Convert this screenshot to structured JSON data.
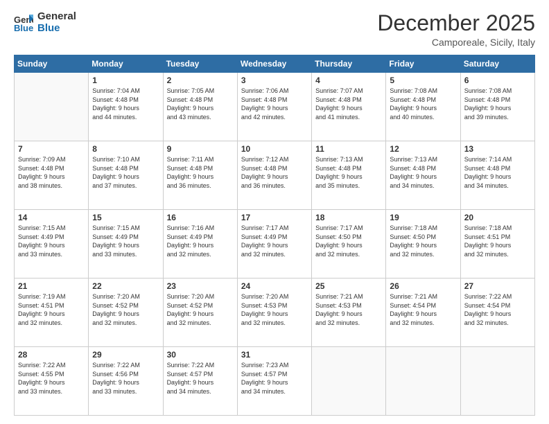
{
  "logo": {
    "line1": "General",
    "line2": "Blue"
  },
  "header": {
    "month": "December 2025",
    "location": "Camporeale, Sicily, Italy"
  },
  "weekdays": [
    "Sunday",
    "Monday",
    "Tuesday",
    "Wednesday",
    "Thursday",
    "Friday",
    "Saturday"
  ],
  "weeks": [
    [
      {
        "day": "",
        "info": ""
      },
      {
        "day": "1",
        "info": "Sunrise: 7:04 AM\nSunset: 4:48 PM\nDaylight: 9 hours\nand 44 minutes."
      },
      {
        "day": "2",
        "info": "Sunrise: 7:05 AM\nSunset: 4:48 PM\nDaylight: 9 hours\nand 43 minutes."
      },
      {
        "day": "3",
        "info": "Sunrise: 7:06 AM\nSunset: 4:48 PM\nDaylight: 9 hours\nand 42 minutes."
      },
      {
        "day": "4",
        "info": "Sunrise: 7:07 AM\nSunset: 4:48 PM\nDaylight: 9 hours\nand 41 minutes."
      },
      {
        "day": "5",
        "info": "Sunrise: 7:08 AM\nSunset: 4:48 PM\nDaylight: 9 hours\nand 40 minutes."
      },
      {
        "day": "6",
        "info": "Sunrise: 7:08 AM\nSunset: 4:48 PM\nDaylight: 9 hours\nand 39 minutes."
      }
    ],
    [
      {
        "day": "7",
        "info": "Sunrise: 7:09 AM\nSunset: 4:48 PM\nDaylight: 9 hours\nand 38 minutes."
      },
      {
        "day": "8",
        "info": "Sunrise: 7:10 AM\nSunset: 4:48 PM\nDaylight: 9 hours\nand 37 minutes."
      },
      {
        "day": "9",
        "info": "Sunrise: 7:11 AM\nSunset: 4:48 PM\nDaylight: 9 hours\nand 36 minutes."
      },
      {
        "day": "10",
        "info": "Sunrise: 7:12 AM\nSunset: 4:48 PM\nDaylight: 9 hours\nand 36 minutes."
      },
      {
        "day": "11",
        "info": "Sunrise: 7:13 AM\nSunset: 4:48 PM\nDaylight: 9 hours\nand 35 minutes."
      },
      {
        "day": "12",
        "info": "Sunrise: 7:13 AM\nSunset: 4:48 PM\nDaylight: 9 hours\nand 34 minutes."
      },
      {
        "day": "13",
        "info": "Sunrise: 7:14 AM\nSunset: 4:48 PM\nDaylight: 9 hours\nand 34 minutes."
      }
    ],
    [
      {
        "day": "14",
        "info": "Sunrise: 7:15 AM\nSunset: 4:49 PM\nDaylight: 9 hours\nand 33 minutes."
      },
      {
        "day": "15",
        "info": "Sunrise: 7:15 AM\nSunset: 4:49 PM\nDaylight: 9 hours\nand 33 minutes."
      },
      {
        "day": "16",
        "info": "Sunrise: 7:16 AM\nSunset: 4:49 PM\nDaylight: 9 hours\nand 32 minutes."
      },
      {
        "day": "17",
        "info": "Sunrise: 7:17 AM\nSunset: 4:49 PM\nDaylight: 9 hours\nand 32 minutes."
      },
      {
        "day": "18",
        "info": "Sunrise: 7:17 AM\nSunset: 4:50 PM\nDaylight: 9 hours\nand 32 minutes."
      },
      {
        "day": "19",
        "info": "Sunrise: 7:18 AM\nSunset: 4:50 PM\nDaylight: 9 hours\nand 32 minutes."
      },
      {
        "day": "20",
        "info": "Sunrise: 7:18 AM\nSunset: 4:51 PM\nDaylight: 9 hours\nand 32 minutes."
      }
    ],
    [
      {
        "day": "21",
        "info": "Sunrise: 7:19 AM\nSunset: 4:51 PM\nDaylight: 9 hours\nand 32 minutes."
      },
      {
        "day": "22",
        "info": "Sunrise: 7:20 AM\nSunset: 4:52 PM\nDaylight: 9 hours\nand 32 minutes."
      },
      {
        "day": "23",
        "info": "Sunrise: 7:20 AM\nSunset: 4:52 PM\nDaylight: 9 hours\nand 32 minutes."
      },
      {
        "day": "24",
        "info": "Sunrise: 7:20 AM\nSunset: 4:53 PM\nDaylight: 9 hours\nand 32 minutes."
      },
      {
        "day": "25",
        "info": "Sunrise: 7:21 AM\nSunset: 4:53 PM\nDaylight: 9 hours\nand 32 minutes."
      },
      {
        "day": "26",
        "info": "Sunrise: 7:21 AM\nSunset: 4:54 PM\nDaylight: 9 hours\nand 32 minutes."
      },
      {
        "day": "27",
        "info": "Sunrise: 7:22 AM\nSunset: 4:54 PM\nDaylight: 9 hours\nand 32 minutes."
      }
    ],
    [
      {
        "day": "28",
        "info": "Sunrise: 7:22 AM\nSunset: 4:55 PM\nDaylight: 9 hours\nand 33 minutes."
      },
      {
        "day": "29",
        "info": "Sunrise: 7:22 AM\nSunset: 4:56 PM\nDaylight: 9 hours\nand 33 minutes."
      },
      {
        "day": "30",
        "info": "Sunrise: 7:22 AM\nSunset: 4:57 PM\nDaylight: 9 hours\nand 34 minutes."
      },
      {
        "day": "31",
        "info": "Sunrise: 7:23 AM\nSunset: 4:57 PM\nDaylight: 9 hours\nand 34 minutes."
      },
      {
        "day": "",
        "info": ""
      },
      {
        "day": "",
        "info": ""
      },
      {
        "day": "",
        "info": ""
      }
    ]
  ]
}
